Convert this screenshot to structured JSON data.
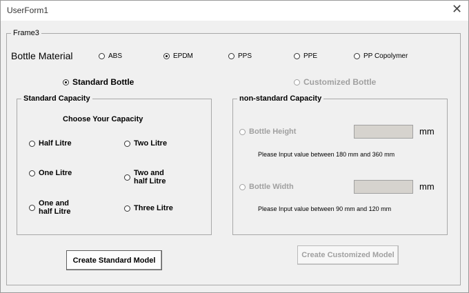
{
  "window": {
    "title": "UserForm1",
    "close_glyph": "✕"
  },
  "frame3": {
    "legend": "Frame3",
    "bottle_material_label": "Bottle Material",
    "materials": [
      {
        "label": "ABS",
        "selected": false
      },
      {
        "label": "EPDM",
        "selected": true
      },
      {
        "label": "PPS",
        "selected": false
      },
      {
        "label": "PPE",
        "selected": false
      },
      {
        "label": "PP Copolymer",
        "selected": false
      }
    ],
    "bottle_type": {
      "standard": {
        "label": "Standard Bottle",
        "selected": true
      },
      "customized": {
        "label": "Customized Bottle",
        "selected": false,
        "enabled": false
      }
    }
  },
  "standard_capacity": {
    "legend": "Standard Capacity",
    "prompt": "Choose Your Capacity",
    "options": [
      {
        "label": "Half Litre",
        "selected": false
      },
      {
        "label": "Two Litre",
        "selected": false
      },
      {
        "label": "One Litre",
        "selected": false
      },
      {
        "label": "Two and\nhalf Litre",
        "selected": false
      },
      {
        "label": "One and\nhalf Litre",
        "selected": false
      },
      {
        "label": "Three Litre",
        "selected": false
      }
    ]
  },
  "nonstandard_capacity": {
    "legend": "non-standard Capacity",
    "height": {
      "label": "Bottle Height",
      "value": "",
      "unit": "mm",
      "hint": "Please Input value between 180 mm and 360 mm",
      "enabled": false
    },
    "width": {
      "label": "Bottle Width",
      "value": "",
      "unit": "mm",
      "hint": "Please Input value between 90 mm and 120 mm",
      "enabled": false
    }
  },
  "buttons": {
    "create_standard": "Create Standard Model",
    "create_customized": "Create Customized Model"
  },
  "colors": {
    "background": "#f0f0f0",
    "disabled_text": "#a0a0a0",
    "disabled_field": "#d6d3ce"
  }
}
